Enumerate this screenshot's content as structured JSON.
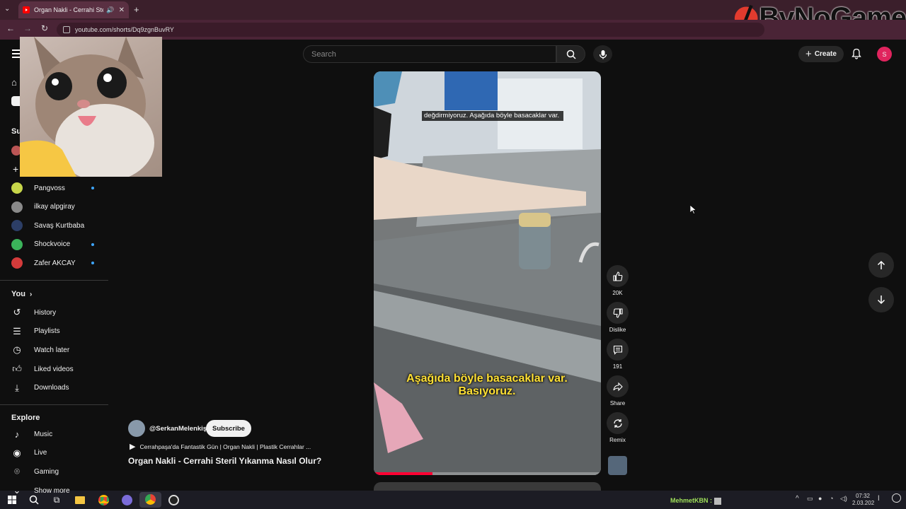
{
  "browser": {
    "tab_title": "Organ Nakli - Cerrahi Steril",
    "tab_new": "+",
    "url": "youtube.com/shorts/Dq9zgnBuvRY"
  },
  "watermark": {
    "text": "ByNoGame"
  },
  "header": {
    "search_placeholder": "Search",
    "create_label": "Create",
    "avatar_initial": "S"
  },
  "sidebar": {
    "subscriptions_head": "Su",
    "channels": [
      {
        "name": "Pangvoss",
        "color": "#c7d64a",
        "new": true
      },
      {
        "name": "ilkay alpgiray",
        "color": "#8a8a8a",
        "new": false
      },
      {
        "name": "Savaş Kurtbaba",
        "color": "#2c3e66",
        "new": false
      },
      {
        "name": "Shockvoice",
        "color": "#3bb35a",
        "new": true
      },
      {
        "name": "Zafer AKCAY",
        "color": "#d43b3b",
        "new": true
      }
    ],
    "you_head": "You",
    "you_items": [
      {
        "label": "History",
        "icon": "history-icon"
      },
      {
        "label": "Playlists",
        "icon": "playlists-icon"
      },
      {
        "label": "Watch later",
        "icon": "watch-later-icon"
      },
      {
        "label": "Liked videos",
        "icon": "liked-videos-icon"
      },
      {
        "label": "Downloads",
        "icon": "downloads-icon"
      }
    ],
    "explore_head": "Explore",
    "explore_items": [
      {
        "label": "Music",
        "icon": "music-icon"
      },
      {
        "label": "Live",
        "icon": "live-icon"
      },
      {
        "label": "Gaming",
        "icon": "gaming-icon"
      },
      {
        "label": "Show more",
        "icon": "chevron-down-icon"
      }
    ]
  },
  "video": {
    "caption_top": "değdirmiyoruz. Aşağıda böyle basacaklar var.",
    "caption_bottom": "Aşağıda böyle basacaklar var. Basıyoruz.",
    "progress": 0.26
  },
  "channel": {
    "handle": "@SerkanMelenkiş",
    "subscribe_label": "Subscribe",
    "playlist": "Cerrahpaşa'da Fantastik Gün | Organ Nakli | Plastik Cerrahlar ...",
    "title": "Organ Nakli - Cerrahi Steril Yıkanma Nasıl Olur?"
  },
  "actions": {
    "like_count": "20K",
    "dislike_label": "Dislike",
    "comments_count": "191",
    "share_label": "Share",
    "remix_label": "Remix"
  },
  "taskbar": {
    "user_label": "MehmetKBN :",
    "time": "07:32",
    "date": "2.03.202"
  }
}
